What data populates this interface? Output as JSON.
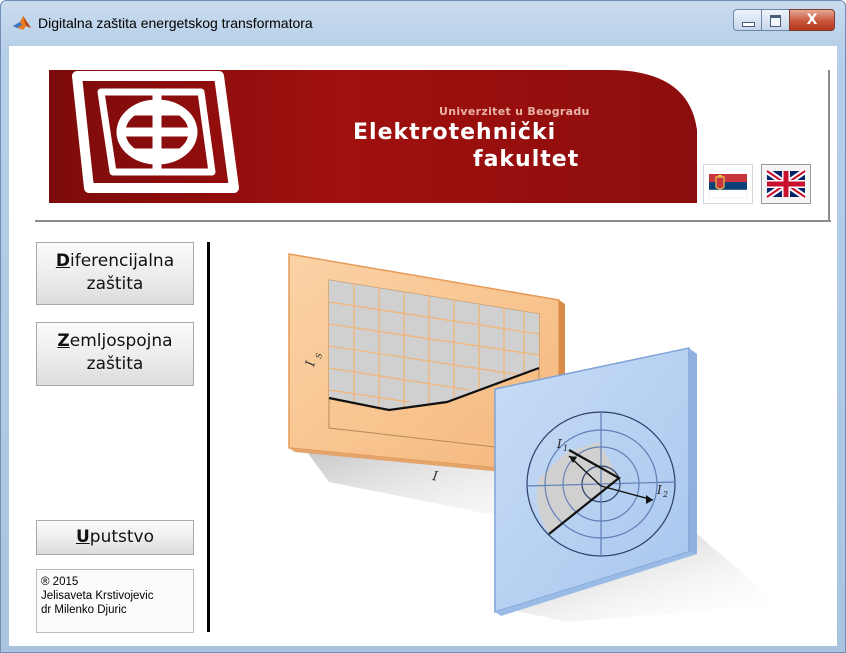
{
  "window": {
    "title": "Digitalna zaštita energetskog transformatora",
    "icon": "matlab-icon",
    "close_glyph": "X"
  },
  "banner": {
    "university": "Univerzitet u Beogradu",
    "faculty_line1": "Elektrotehnički",
    "faculty_line2": "fakultet",
    "logo": "etf-logo",
    "colors": {
      "banner": "#a0100f",
      "banner_dark": "#7d0b0b"
    }
  },
  "languages": [
    {
      "name": "flag-serbia-icon",
      "selected": true
    },
    {
      "name": "flag-uk-icon",
      "selected": false
    }
  ],
  "buttons": {
    "differential": {
      "accel": "D",
      "rest": "iferencijalna",
      "line2": "zaštita"
    },
    "earth_fault": {
      "accel": "Z",
      "rest": "emljospojna",
      "line2": "zaštita"
    },
    "manual": {
      "accel": "U",
      "rest": "putstvo"
    }
  },
  "credits": {
    "copyright": "® 2015",
    "author1": "Jelisaveta Krstivojevic",
    "author2": "dr Milenko Djuric"
  },
  "illustration": {
    "panel1_color": "#f7c08a",
    "panel2_color": "#b4d0f2",
    "label_is": "I",
    "label_is_sub": "S",
    "label_i": "I",
    "label_i1": "I",
    "label_i1_sub": "1",
    "label_i2": "I",
    "label_i2_sub": "2"
  }
}
